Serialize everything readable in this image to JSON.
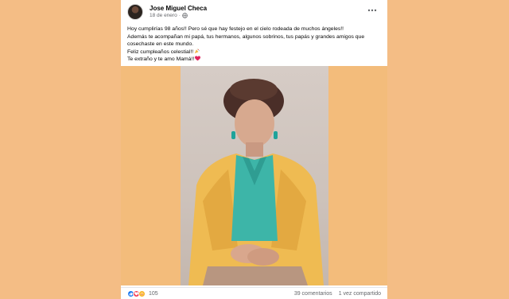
{
  "post": {
    "author": "Jose Miguel Checa",
    "date": "18 de enero",
    "date_separator": "·",
    "privacy_icon": "globe-icon",
    "more_icon": "more-options-icon",
    "text_lines": [
      "Hoy cumplirías 98 años!! Pero sé que hay festejo en el cielo rodeada de muchos ángeles!!",
      "Además te acompañan mi papá, tus hermanos, algunos sobrinos, tus papás y grandes amigos que",
      "cosechaste en este mundo.",
      "Feliz cumpleaños celestial!!",
      "Te extraño y te amo Mamá!!"
    ],
    "emoji_icons": [
      "celebration-icon",
      "red-heart-icon"
    ]
  },
  "image": {
    "description": "portrait-photo"
  },
  "footer": {
    "reaction_icons": [
      "like-icon",
      "love-icon",
      "care-icon"
    ],
    "reaction_count": "105",
    "comments": "39 comentarios",
    "shares": "1 vez compartido"
  },
  "colors": {
    "page_bg": "#f4bd85",
    "photo_bg": "#f3bc7b",
    "like": "#1877f2",
    "love": "#f33e58",
    "care": "#f7b125",
    "secondary_text": "#65676b"
  }
}
